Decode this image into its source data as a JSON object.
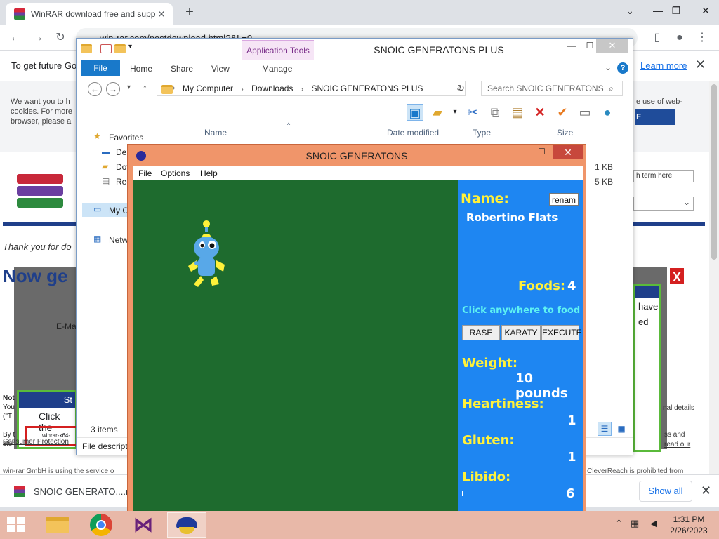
{
  "browser": {
    "tab_title": "WinRAR download free and supp",
    "url": "win-rar.com/postdownload.html?&L=0",
    "infobar_message": "To get future Go",
    "learn_more": "Learn more",
    "download_file": "SNOIC GENERATO....rar",
    "show_all": "Show all"
  },
  "webpage": {
    "cookie_text": "We want you to h cookies. For more browser, please a",
    "cookie_right": "e use of web-",
    "cookie_button": "E",
    "search_placeholder": "h term here",
    "thanks": "Thank you for do",
    "headline": "Now ge",
    "email_label": "E-Ma",
    "modal_right_1": "have",
    "modal_right_2": "ed",
    "note_1": "Not",
    "note_2": "You",
    "note_3": "(\"T",
    "note_4": "By t",
    "note_5": "stor",
    "green_box_header": "St",
    "green_box_text": "Click the",
    "green_box_file": "winrar-x64-",
    "right_text_1": "nal details",
    "right_text_2": "ss and",
    "right_text_3": "read our",
    "consumer": "Consumer Protection",
    "footer": "win-rar GmbH is using the service o",
    "footer_right": "CleverReach is prohibited from"
  },
  "explorer": {
    "title": "SNOIC GENERATONS PLUS",
    "app_tools": "Application Tools",
    "ribbon_tabs": [
      "File",
      "Home",
      "Share",
      "View",
      "Manage"
    ],
    "breadcrumb": [
      "My Computer",
      "Downloads",
      "SNOIC GENERATONS PLUS"
    ],
    "search_placeholder": "Search SNOIC GENERATONS ...",
    "columns": [
      "Name",
      "Date modified",
      "Type",
      "Size"
    ],
    "nav": {
      "favorites": "Favorites",
      "desktop": "Des",
      "downloads": "Dov",
      "recent": "Rec",
      "my_computer": "My C",
      "network": "Netw"
    },
    "sizes": [
      "1 KB",
      "5 KB"
    ],
    "item_count": "3 items",
    "file_description": "File descripti"
  },
  "game": {
    "title": "SNOIC GENERATONS",
    "menu": [
      "File",
      "Options",
      "Help"
    ],
    "name_label": "Name:",
    "rename_button": "renam",
    "pet_name": "Robertino Flats",
    "foods_label": "Foods:",
    "foods_value": "4",
    "hint": "Click anywhere to food",
    "buttons": [
      "RASE",
      "KARATY",
      "EXECUTE"
    ],
    "weight_label": "Weight:",
    "weight_value": "10 pounds",
    "heartiness_label": "Heartiness:",
    "heartiness_value": "1",
    "gluten_label": "Gluten:",
    "gluten_value": "1",
    "libido_label": "Libido:",
    "libido_value": "6",
    "colors": {
      "play_area": "#1e6b2e",
      "panel": "#1e86f2",
      "label_yellow": "#fff13a",
      "hint_cyan": "#5ef2f2"
    }
  },
  "taskbar": {
    "time": "1:31 PM",
    "date": "2/26/2023",
    "apps": [
      "file-explorer-icon",
      "chrome-icon",
      "visual-studio-icon",
      "snoic-game-icon"
    ]
  }
}
